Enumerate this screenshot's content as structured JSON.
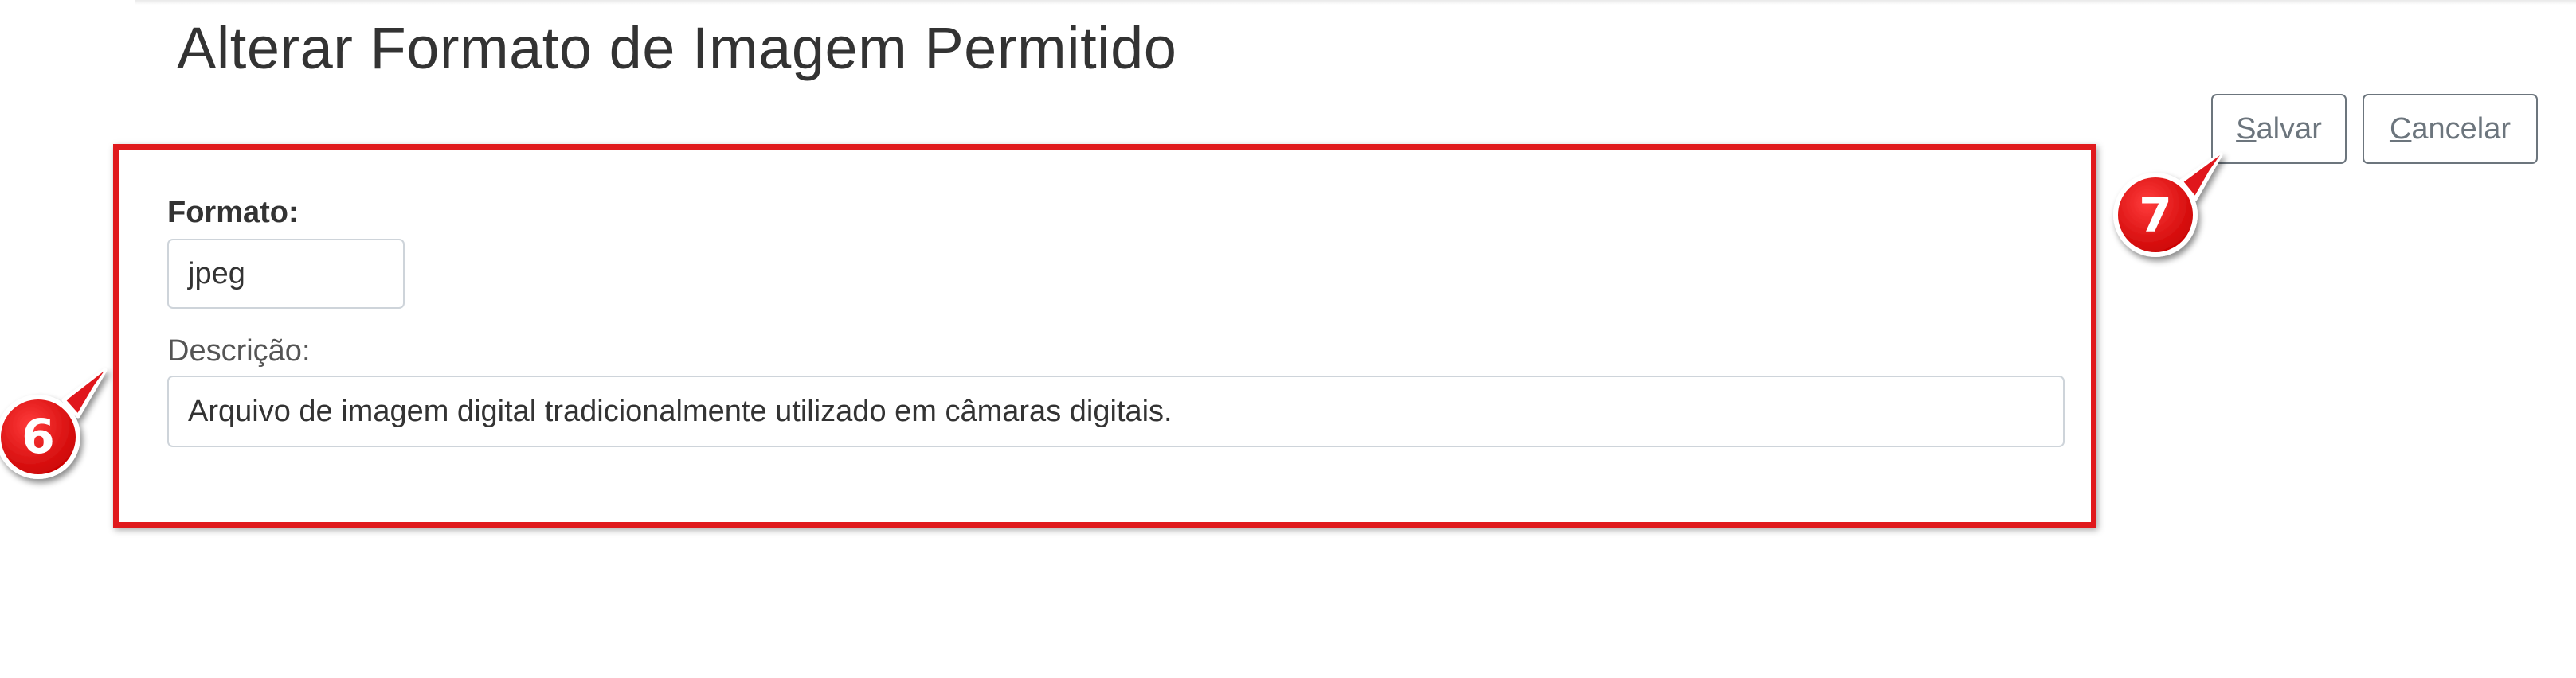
{
  "page": {
    "title": "Alterar Formato de Imagem Permitido"
  },
  "toolbar": {
    "save_label_underlined": "S",
    "save_label_rest": "alvar",
    "cancel_label_underlined": "C",
    "cancel_label_rest": "ancelar"
  },
  "form": {
    "format_label": "Formato:",
    "format_value": "jpeg",
    "description_label": "Descrição:",
    "description_value": "Arquivo de imagem digital tradicionalmente utilizado em câmaras digitais."
  },
  "callouts": {
    "step_6": "6",
    "step_7": "7",
    "color": "#e0191c"
  }
}
